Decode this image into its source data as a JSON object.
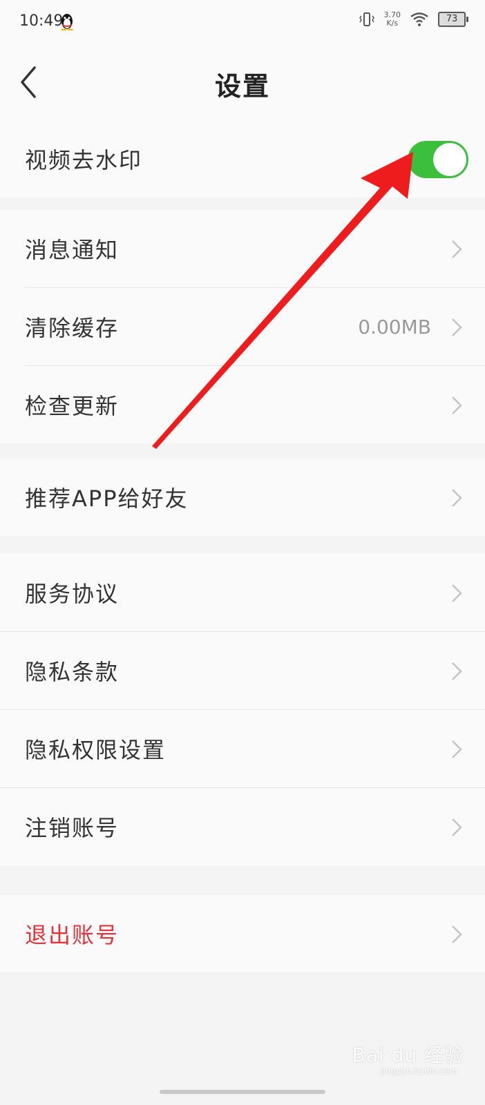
{
  "status_bar": {
    "time": "10:49",
    "net_speed": "3.70",
    "net_unit": "K/s",
    "battery": "73",
    "icons": [
      "qq-penguin-icon",
      "vibrate-icon",
      "wifi-icon",
      "battery-icon"
    ]
  },
  "header": {
    "title": "设置",
    "back_icon": "chevron-left-icon"
  },
  "watermark_toggle": {
    "label": "视频去水印",
    "enabled": true
  },
  "group1": [
    {
      "label": "消息通知"
    },
    {
      "label": "清除缓存",
      "value": "0.00MB"
    },
    {
      "label": "检查更新"
    }
  ],
  "group2": [
    {
      "label": "推荐APP给好友"
    }
  ],
  "group3": [
    {
      "label": "服务协议"
    },
    {
      "label": "隐私条款"
    },
    {
      "label": "隐私权限设置"
    },
    {
      "label": "注销账号"
    }
  ],
  "group4": [
    {
      "label": "退出账号"
    }
  ],
  "colors": {
    "toggle_on": "#3cbf3c",
    "danger": "#e8323a",
    "annotation_arrow": "#ee1c1c"
  },
  "watermark": {
    "brand": "Bai du 经验",
    "site": "jingyan.baidu.com"
  }
}
